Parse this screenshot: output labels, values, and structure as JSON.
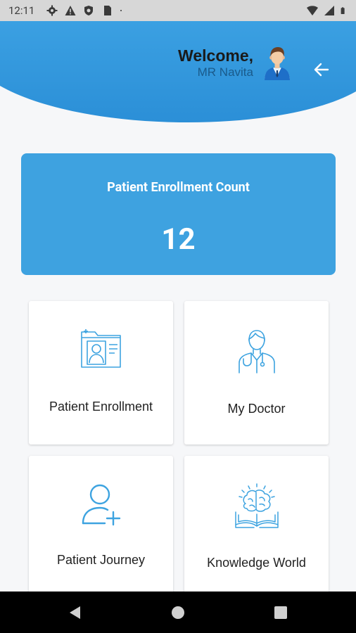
{
  "status_bar": {
    "time": "12:11",
    "icons_left": [
      "gear-icon",
      "warning-icon",
      "shield-icon",
      "sim-card-icon",
      "dot-icon"
    ],
    "icons_right": [
      "wifi-icon",
      "signal-icon",
      "battery-icon"
    ]
  },
  "header": {
    "welcome_title": "Welcome,",
    "user_name": "MR Navita",
    "avatar_icon": "doctor-avatar",
    "back_icon": "arrow-left-icon",
    "gradient_top": "#3a9fe0",
    "gradient_bottom": "#2d8fd6"
  },
  "count_card": {
    "label": "Patient Enrollment Count",
    "value": "12",
    "color": "#3ea2e0"
  },
  "tiles": [
    {
      "label": "Patient Enrollment",
      "icon": "patient-folder-icon"
    },
    {
      "label": "My Doctor",
      "icon": "doctor-icon"
    },
    {
      "label": "Patient Journey",
      "icon": "add-user-icon"
    },
    {
      "label": "Knowledge World",
      "icon": "brain-book-icon"
    }
  ],
  "icon_color": "#3da3e0",
  "nav_bar": {
    "buttons": [
      "back-triangle-icon",
      "home-circle-icon",
      "recents-square-icon"
    ]
  }
}
